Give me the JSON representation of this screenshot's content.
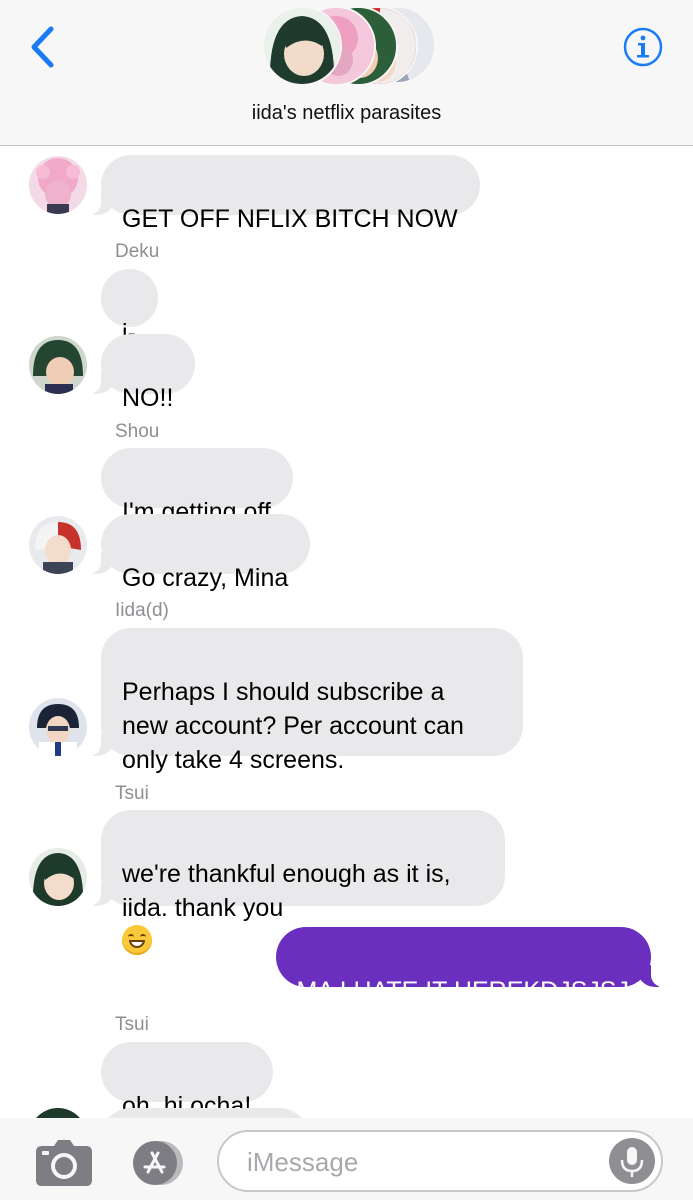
{
  "header": {
    "group_name": "iida's netflix parasites"
  },
  "messages": [
    {
      "sender": "",
      "text": "GET OFF NFLIX BITCH NOW",
      "avatar": "mina"
    },
    {
      "sender": "Deku",
      "text": "i-"
    },
    {
      "sender": "",
      "text": "NO!!",
      "avatar": "deku"
    },
    {
      "sender": "Shou",
      "text": "I'm getting off"
    },
    {
      "sender": "",
      "text": "Go crazy, Mina",
      "avatar": "shou"
    },
    {
      "sender": "Iida(d)",
      "text": "Perhaps I should subscribe a\nnew account? Per account can\nonly take 4 screens.",
      "avatar": "iida"
    },
    {
      "sender": "Tsui",
      "text": "we're thankful enough as it is,\niida. thank you",
      "emoji": "grinning-face",
      "avatar": "tsui"
    },
    {
      "sender": "",
      "text": "MA I HATE IT HEREKDJSJSJ",
      "outgoing": true
    },
    {
      "sender": "Tsui",
      "text": "oh, hi ocha!"
    }
  ],
  "input": {
    "placeholder": "iMessage"
  },
  "colors": {
    "accent": "#1a7cf5",
    "incoming_bubble": "#e9e9eb",
    "outgoing_bubble": "#6b2fbf",
    "sender_label": "#8e8e93"
  },
  "icons": [
    "back-chevron-icon",
    "info-icon",
    "camera-icon",
    "app-store-icon",
    "microphone-icon",
    "grinning-face-emoji"
  ]
}
